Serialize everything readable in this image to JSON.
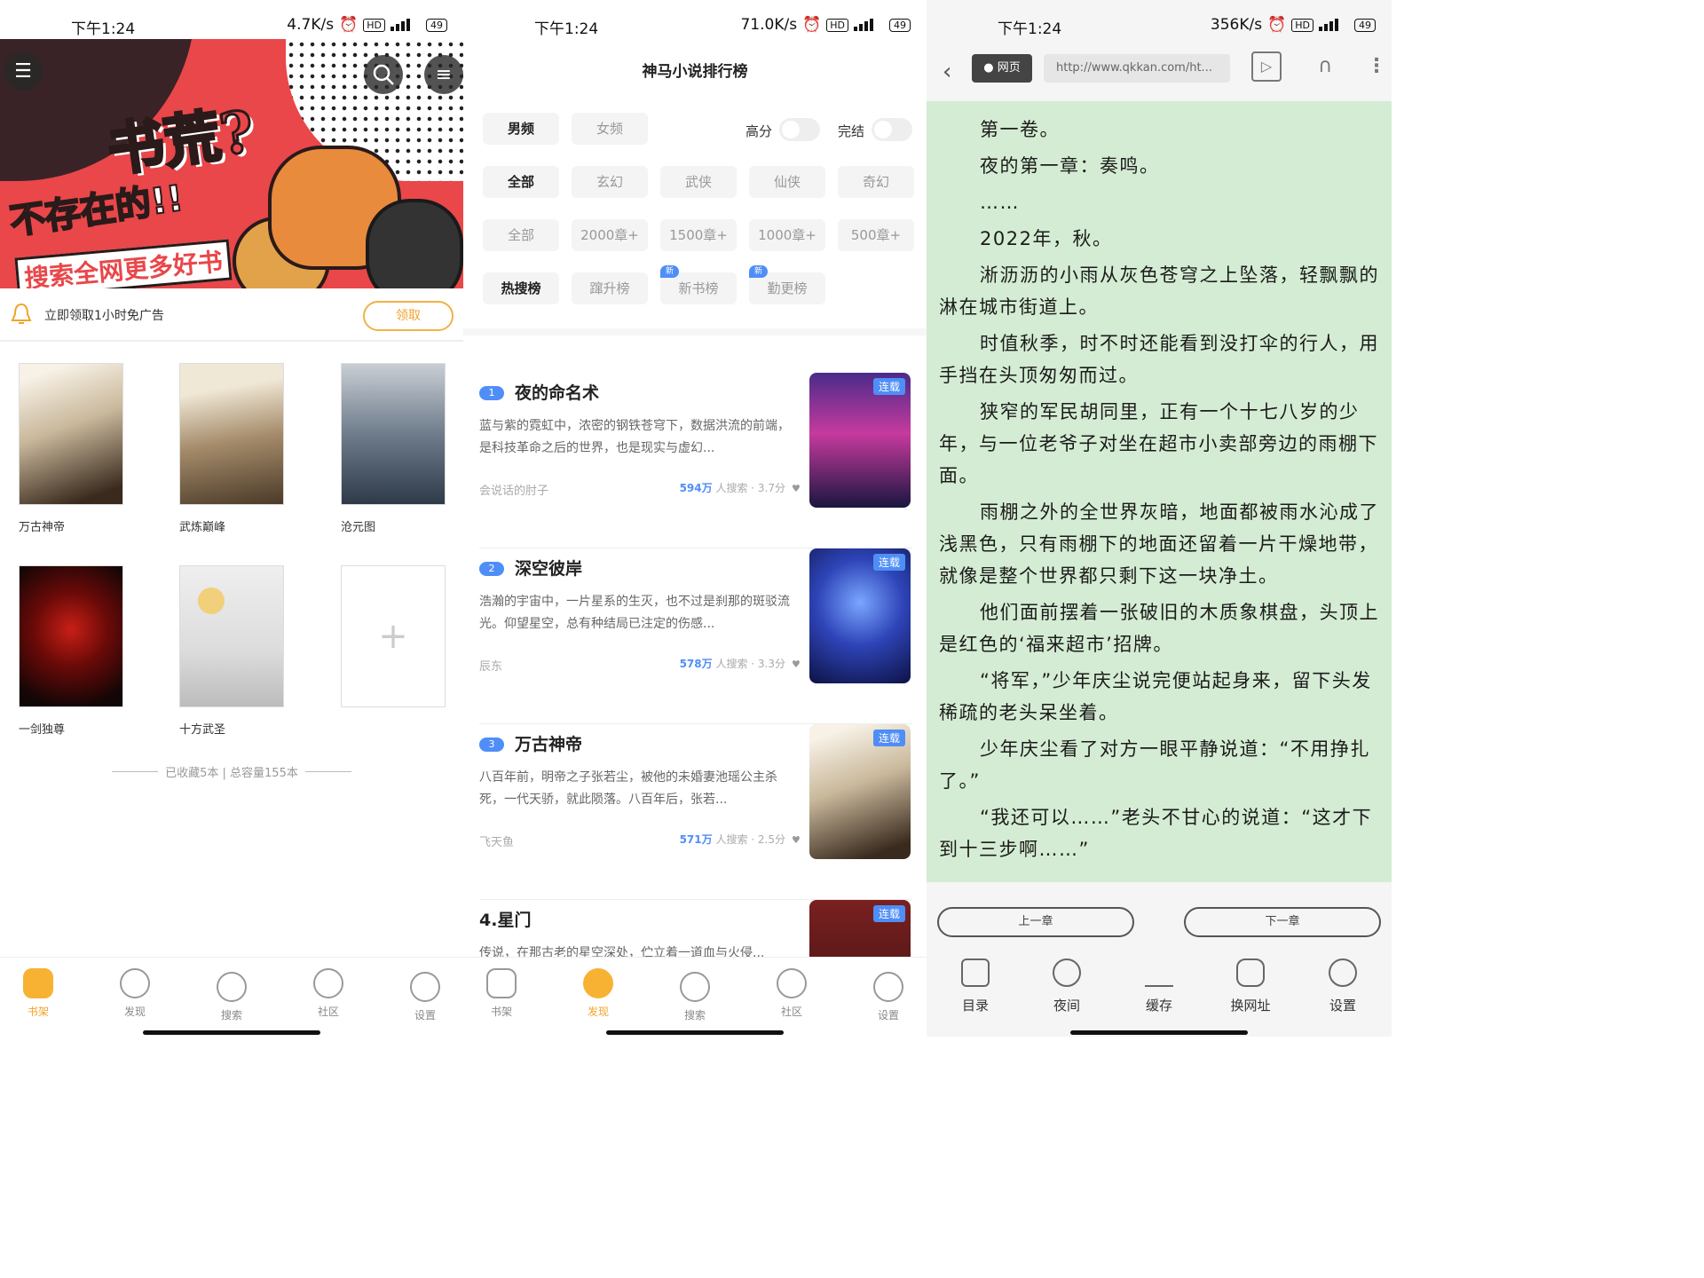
{
  "panel1": {
    "status": {
      "time": "下午1:24",
      "speed": "4.7K/s",
      "hd": "HD",
      "net": "5G",
      "battery": "49"
    },
    "banner": {
      "line1": "书荒?",
      "line2": "不存在的!!",
      "line3": "搜索全网更多好书"
    },
    "ad": {
      "text": "立即领取1小时免广告",
      "button": "领取"
    },
    "books": [
      {
        "name": "万古神帝"
      },
      {
        "name": "武炼巅峰"
      },
      {
        "name": "沧元图"
      },
      {
        "name": "一剑独尊"
      },
      {
        "name": "十方武圣"
      }
    ],
    "collection_summary": "已收藏5本 | 总容量155本",
    "tabs": [
      {
        "label": "书架",
        "icon": "bookshelf-icon"
      },
      {
        "label": "发现",
        "icon": "discover-icon"
      },
      {
        "label": "搜索",
        "icon": "search-icon"
      },
      {
        "label": "社区",
        "icon": "community-icon"
      },
      {
        "label": "设置",
        "icon": "gear-icon"
      }
    ],
    "active_tab": "书架"
  },
  "panel2": {
    "status": {
      "time": "下午1:24",
      "speed": "71.0K/s",
      "hd": "HD",
      "net": "5G",
      "battery": "49"
    },
    "title": "神马小说排行榜",
    "gender": [
      "男频",
      "女频"
    ],
    "toggles": [
      "高分",
      "完结"
    ],
    "genres": [
      "全部",
      "玄幻",
      "武侠",
      "仙侠",
      "奇幻"
    ],
    "lengths": [
      "全部",
      "2000章+",
      "1500章+",
      "1000章+",
      "500章+"
    ],
    "lists": [
      "热搜榜",
      "蹿升榜",
      "新书榜",
      "勤更榜"
    ],
    "new_tag": "新",
    "items": [
      {
        "rank": "1",
        "title": "夜的命名术",
        "desc": "蓝与紫的霓虹中，浓密的钢铁苍穹下，数据洪流的前端，是科技革命之后的世界，也是现实与虚幻...",
        "author": "会说话的肘子",
        "searches": "594万",
        "search_suffix": "人搜索 · 3.7分",
        "tag": "连载"
      },
      {
        "rank": "2",
        "title": "深空彼岸",
        "desc": "浩瀚的宇宙中，一片星系的生灭，也不过是刹那的斑驳流光。仰望星空，总有种结局已注定的伤感...",
        "author": "辰东",
        "searches": "578万",
        "search_suffix": "人搜索 · 3.3分",
        "tag": "连载"
      },
      {
        "rank": "3",
        "title": "万古神帝",
        "desc": "八百年前，明帝之子张若尘，被他的未婚妻池瑶公主杀死，一代天骄，就此陨落。八百年后，张若...",
        "author": "飞天鱼",
        "searches": "571万",
        "search_suffix": "人搜索 · 2.5分",
        "tag": "连载"
      },
      {
        "rank": "",
        "title": "4.星门",
        "desc": "传说，在那古老的星空深处，伫立着一道血与火侵...",
        "author": "",
        "searches": "",
        "search_suffix": "",
        "tag": "连载"
      }
    ],
    "tabs": [
      {
        "label": "书架",
        "icon": "bookshelf-icon"
      },
      {
        "label": "发现",
        "icon": "discover-icon"
      },
      {
        "label": "搜索",
        "icon": "search-icon"
      },
      {
        "label": "社区",
        "icon": "community-icon"
      },
      {
        "label": "设置",
        "icon": "gear-icon"
      }
    ],
    "active_tab": "发现"
  },
  "panel3": {
    "status": {
      "time": "下午1:24",
      "speed": "356K/s",
      "hd": "HD",
      "net": "5G",
      "battery": "49"
    },
    "web_label": "网页",
    "url": "http://www.qkkan.com/ht...",
    "paragraphs": [
      "第一卷。",
      "夜的第一章：奏鸣。",
      "……",
      "2022年，秋。",
      "淅沥沥的小雨从灰色苍穹之上坠落，轻飘飘的淋在城市街道上。",
      "时值秋季，时不时还能看到没打伞的行人，用手挡在头顶匆匆而过。",
      "狭窄的军民胡同里，正有一个十七八岁的少年，与一位老爷子对坐在超市小卖部旁边的雨棚下面。",
      "雨棚之外的全世界灰暗，地面都被雨水沁成了浅黑色，只有雨棚下的地面还留着一片干燥地带，就像是整个世界都只剩下这一块净土。",
      "他们面前摆着一张破旧的木质象棋盘，头顶上是红色的‘福来超市’招牌。",
      "“将军，”少年庆尘说完便站起身来，留下头发稀疏的老头呆坐着。",
      "少年庆尘看了对方一眼平静说道：“不用挣扎了。”",
      "“我还可以……”老头不甘心的说道：“这才下到十三步啊……”"
    ],
    "prev_chapter": "上一章",
    "next_chapter": "下一章",
    "tabs": [
      {
        "label": "目录",
        "icon": "catalog-icon"
      },
      {
        "label": "夜间",
        "icon": "moon-icon"
      },
      {
        "label": "缓存",
        "icon": "download-icon"
      },
      {
        "label": "换网址",
        "icon": "switch-source-icon"
      },
      {
        "label": "设置",
        "icon": "gear-icon"
      }
    ]
  }
}
